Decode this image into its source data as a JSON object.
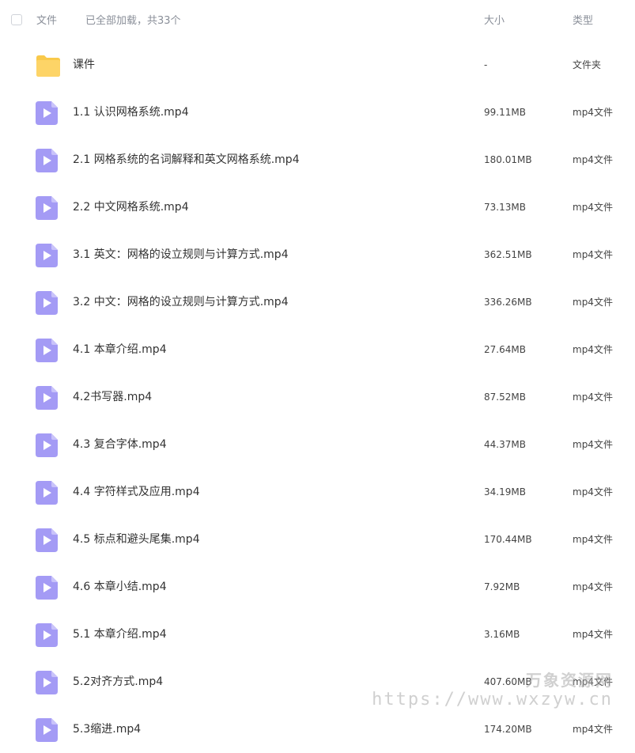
{
  "header": {
    "col_file": "文件",
    "status": "已全部加载，共33个",
    "col_size": "大小",
    "col_type": "类型"
  },
  "colors": {
    "folder": "#fdd467",
    "video": "#a49bf5",
    "text": "#333333",
    "muted": "#8a8f99"
  },
  "files": [
    {
      "icon": "folder-icon",
      "name": "课件",
      "size": "-",
      "type": "文件夹"
    },
    {
      "icon": "video-file-icon",
      "name": "1.1 认识网格系统.mp4",
      "size": "99.11MB",
      "type": "mp4文件"
    },
    {
      "icon": "video-file-icon",
      "name": "2.1 网格系统的名词解释和英文网格系统.mp4",
      "size": "180.01MB",
      "type": "mp4文件"
    },
    {
      "icon": "video-file-icon",
      "name": "2.2 中文网格系统.mp4",
      "size": "73.13MB",
      "type": "mp4文件"
    },
    {
      "icon": "video-file-icon",
      "name": "3.1 英文：网格的设立规则与计算方式.mp4",
      "size": "362.51MB",
      "type": "mp4文件"
    },
    {
      "icon": "video-file-icon",
      "name": "3.2 中文：网格的设立规则与计算方式.mp4",
      "size": "336.26MB",
      "type": "mp4文件"
    },
    {
      "icon": "video-file-icon",
      "name": "4.1 本章介绍.mp4",
      "size": "27.64MB",
      "type": "mp4文件"
    },
    {
      "icon": "video-file-icon",
      "name": "4.2书写器.mp4",
      "size": "87.52MB",
      "type": "mp4文件"
    },
    {
      "icon": "video-file-icon",
      "name": "4.3 复合字体.mp4",
      "size": "44.37MB",
      "type": "mp4文件"
    },
    {
      "icon": "video-file-icon",
      "name": "4.4 字符样式及应用.mp4",
      "size": "34.19MB",
      "type": "mp4文件"
    },
    {
      "icon": "video-file-icon",
      "name": "4.5 标点和避头尾集.mp4",
      "size": "170.44MB",
      "type": "mp4文件"
    },
    {
      "icon": "video-file-icon",
      "name": "4.6 本章小结.mp4",
      "size": "7.92MB",
      "type": "mp4文件"
    },
    {
      "icon": "video-file-icon",
      "name": "5.1 本章介绍.mp4",
      "size": "3.16MB",
      "type": "mp4文件"
    },
    {
      "icon": "video-file-icon",
      "name": "5.2对齐方式.mp4",
      "size": "407.60MB",
      "type": "mp4文件"
    },
    {
      "icon": "video-file-icon",
      "name": "5.3缩进.mp4",
      "size": "174.20MB",
      "type": "mp4文件"
    }
  ],
  "watermark": {
    "line1": "万象资源网",
    "line2": "https://www.wxzyw.cn"
  }
}
